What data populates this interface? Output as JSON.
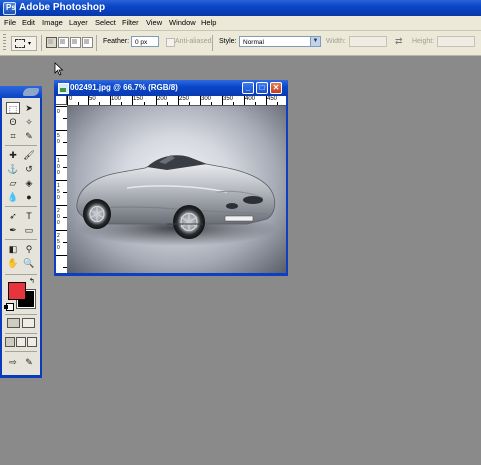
{
  "app": {
    "title": "Adobe Photoshop",
    "icon": "photoshop-icon"
  },
  "menu": [
    "File",
    "Edit",
    "Image",
    "Layer",
    "Select",
    "Filter",
    "View",
    "Window",
    "Help"
  ],
  "options": {
    "feather_label": "Feather:",
    "feather_value": "0 px",
    "antialiased_label": "Anti-aliased",
    "style_label": "Style:",
    "style_value": "Normal",
    "width_label": "Width:",
    "height_label": "Height:"
  },
  "document": {
    "title": "002491.jpg @ 66.7% (RGB/8)",
    "ruler_top": [
      "0",
      "50",
      "100",
      "150",
      "200",
      "250",
      "300",
      "350",
      "400",
      "450"
    ],
    "ruler_left": [
      "0",
      "5\n0",
      "1\n0\n0",
      "1\n5\n0",
      "2\n0\n0",
      "2\n5\n0"
    ]
  },
  "colors": {
    "foreground": "#e8343c",
    "background": "#000000",
    "workspace": "#8a8a8a",
    "titlebar": "#0a46c8"
  },
  "tools": [
    "rectangular-marquee",
    "move",
    "lasso",
    "magic-wand",
    "crop",
    "slice",
    "healing-brush",
    "brush",
    "clone-stamp",
    "history-brush",
    "eraser",
    "paint-bucket",
    "blur",
    "dodge",
    "path-selection",
    "type",
    "pen",
    "shape",
    "notes",
    "eyedropper",
    "hand",
    "zoom"
  ]
}
